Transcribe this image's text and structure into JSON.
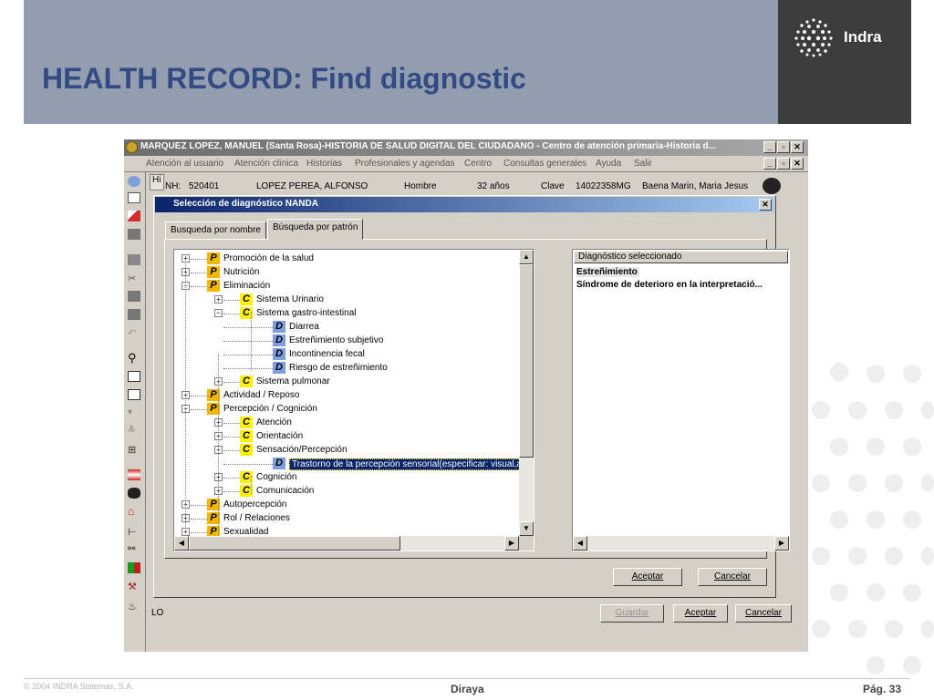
{
  "slide": {
    "title": "HEALTH RECORD: Find diagnostic",
    "brand": "Indra",
    "footer_copyright": "© 2004 INDRA Sistemas, S.A.",
    "footer_center": "Diraya",
    "footer_page": "Pág. 33"
  },
  "app": {
    "window_title": "MARQUEZ LOPEZ, MANUEL (Santa Rosa)-HISTORIA DE SALUD DIGITAL  DEL CIUDADANO - Centro de atención primaria-Historia d...",
    "menu": [
      "Atención al usuario",
      "Atención clínica",
      "Historias",
      "Profesionales y agendas",
      "Centro",
      "Consultas generales",
      "Ayuda",
      "Salir"
    ],
    "tab_stub": "Hi",
    "side_label": "LO",
    "patient": {
      "nh_label": "NH:",
      "nh_value": "520401",
      "name": "LOPEZ PEREA, ALFONSO",
      "sex": "Hombre",
      "age": "32 años",
      "clave_label": "Clave",
      "clave_value": "14022358MG",
      "doctor": "Baena Marin, Maria Jesus"
    },
    "bottom_buttons": {
      "guardar": "Guardar",
      "aceptar": "Aceptar",
      "cancelar": "Cancelar"
    }
  },
  "dialog": {
    "title": "Selección de diagnóstico NANDA",
    "tabs": [
      "Busqueda por nombre",
      "Búsqueda por patrón"
    ],
    "active_tab": "Búsqueda por patrón",
    "tree": [
      {
        "level": 0,
        "type": "P",
        "label": "Promoción de la salud",
        "expander": "+"
      },
      {
        "level": 0,
        "type": "P",
        "label": "Nutrición",
        "expander": "+"
      },
      {
        "level": 0,
        "type": "P",
        "label": "Eliminación",
        "expander": "-"
      },
      {
        "level": 1,
        "type": "C",
        "label": "Sistema Urinario",
        "expander": "+"
      },
      {
        "level": 1,
        "type": "C",
        "label": "Sistema gastro-intestinal",
        "expander": "-"
      },
      {
        "level": 2,
        "type": "D",
        "label": "Diarrea"
      },
      {
        "level": 2,
        "type": "D",
        "label": "Estreñimiento subjetivo"
      },
      {
        "level": 2,
        "type": "D",
        "label": "Incontinencia fecal"
      },
      {
        "level": 2,
        "type": "D",
        "label": "Riesgo de estreñimiento"
      },
      {
        "level": 1,
        "type": "C",
        "label": "Sistema pulmonar",
        "expander": "+"
      },
      {
        "level": 0,
        "type": "P",
        "label": "Actividad / Reposo",
        "expander": "+"
      },
      {
        "level": 0,
        "type": "P",
        "label": "Percepción / Cognición",
        "expander": "-"
      },
      {
        "level": 1,
        "type": "C",
        "label": "Atención",
        "expander": "+"
      },
      {
        "level": 1,
        "type": "C",
        "label": "Orientación",
        "expander": "+"
      },
      {
        "level": 1,
        "type": "C",
        "label": "Sensación/Percepción",
        "expander": "-"
      },
      {
        "level": 2,
        "type": "D",
        "label": "Trastorno de la percepción sensorial(especificar: visual,au",
        "selected": true
      },
      {
        "level": 1,
        "type": "C",
        "label": "Cognición",
        "expander": "+"
      },
      {
        "level": 1,
        "type": "C",
        "label": "Comunicación",
        "expander": "+"
      },
      {
        "level": 0,
        "type": "P",
        "label": "Autopercepción",
        "expander": "+"
      },
      {
        "level": 0,
        "type": "P",
        "label": "Rol / Relaciones",
        "expander": "+"
      },
      {
        "level": 0,
        "type": "P",
        "label": "Sexualidad",
        "expander": "+"
      }
    ],
    "selected_header": "Diagnóstico seleccionado",
    "selected_items": [
      "Estreñimiento",
      "Síndrome de deterioro en la interpretació..."
    ],
    "buttons": {
      "aceptar": "Aceptar",
      "cancelar": "Cancelar"
    }
  },
  "colors": {
    "header_bg": "#929daf",
    "title_color": "#334a82",
    "logo_bg": "#3c3c3c",
    "badge_P": "#f3b700",
    "badge_C": "#fff200",
    "badge_D": "#7f9ee0",
    "selection": "#0a246a"
  }
}
